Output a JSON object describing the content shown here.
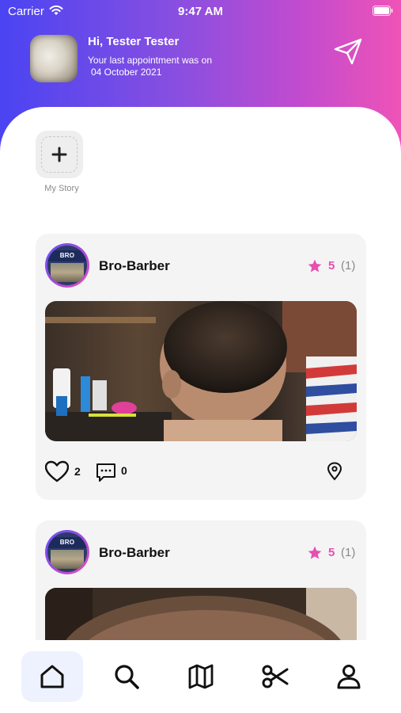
{
  "status_bar": {
    "carrier": "Carrier",
    "time": "9:47 AM"
  },
  "header": {
    "greeting": "Hi, Tester Tester",
    "last_appointment_text": "Your last appointment was on",
    "last_appointment_date": "04 October 2021"
  },
  "stories": {
    "my_story_label": "My Story"
  },
  "posts": [
    {
      "shop_sign": "BRO BARBER",
      "shop_name": "Bro-Barber",
      "rating": "5",
      "rating_count": "(1)",
      "likes": "2",
      "comments": "0"
    },
    {
      "shop_sign": "BRO BARBER",
      "shop_name": "Bro-Barber",
      "rating": "5",
      "rating_count": "(1)"
    }
  ],
  "tabs": [
    {
      "icon": "home-icon",
      "active": true
    },
    {
      "icon": "search-icon",
      "active": false
    },
    {
      "icon": "map-icon",
      "active": false
    },
    {
      "icon": "scissors-icon",
      "active": false
    },
    {
      "icon": "profile-icon",
      "active": false
    }
  ],
  "colors": {
    "gradient_start": "#4a44f2",
    "gradient_end": "#ef53b6",
    "accent_pink": "#e74fb0",
    "card_bg": "#f4f4f5",
    "active_tab_bg": "#eef2ff"
  }
}
